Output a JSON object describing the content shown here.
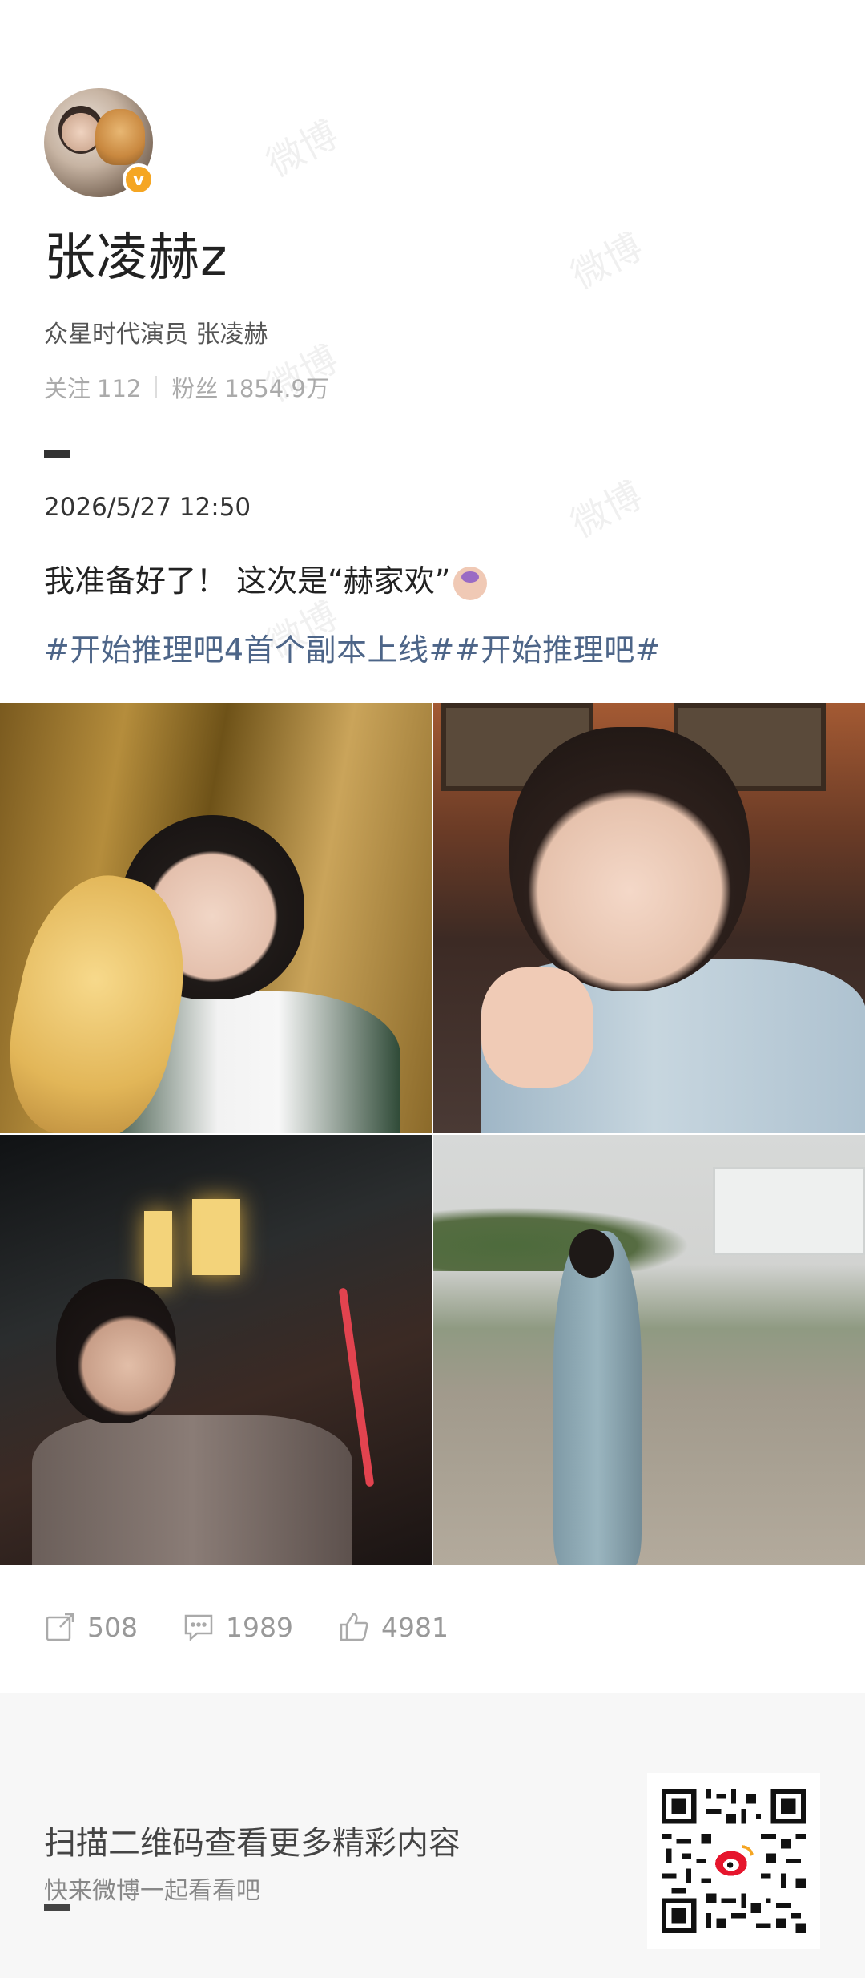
{
  "watermark": "微博",
  "profile": {
    "username": "张凌赫z",
    "bio": "众星时代演员 张凌赫",
    "following_label": "关注",
    "following_count": "112",
    "followers_label": "粉丝",
    "followers_count": "1854.9万",
    "verified_badge": "v"
  },
  "post": {
    "timestamp": "2026/5/27 12:50",
    "text": "我准备好了！ 这次是“赫家欢”",
    "emoji": "person-raising-hand-emoji",
    "hashtags": "#开始推理吧4首个副本上线##开始推理吧#"
  },
  "actions": {
    "repost_count": "508",
    "comment_count": "1989",
    "like_count": "4981"
  },
  "footer": {
    "title": "扫描二维码查看更多精彩内容",
    "subtitle": "快来微博一起看看吧"
  },
  "colors": {
    "hashtag": "#4d6588",
    "verified": "#f5a623",
    "muted": "#999999"
  }
}
